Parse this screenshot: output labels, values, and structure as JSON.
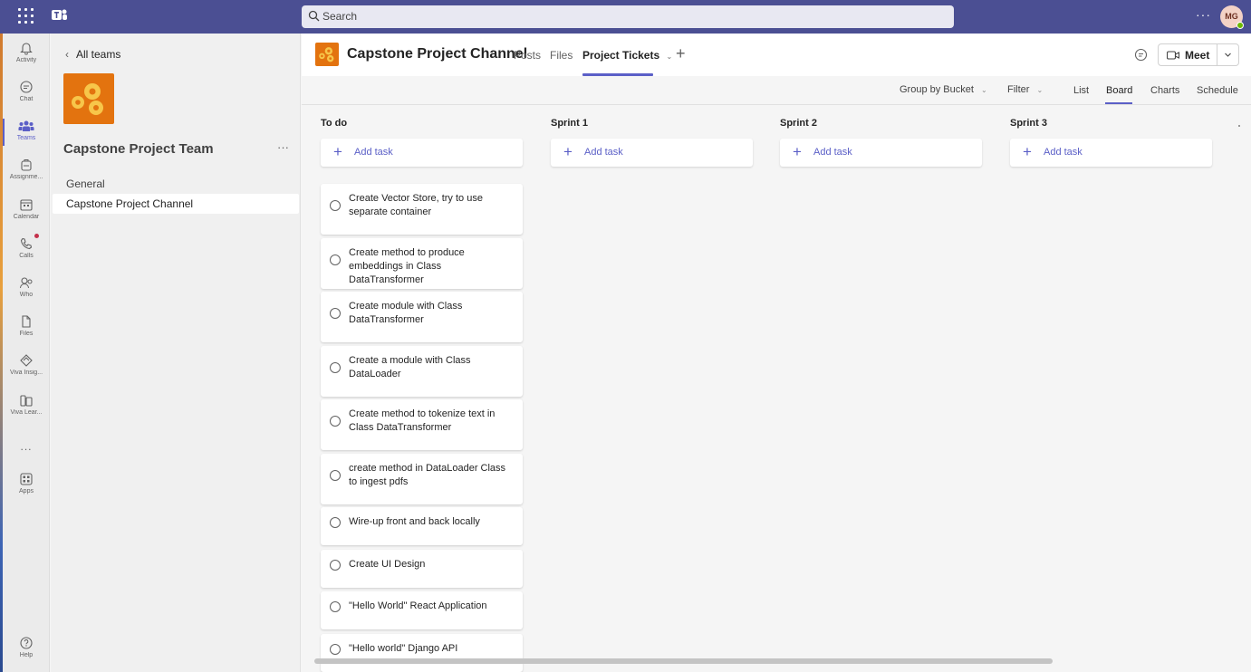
{
  "topbar": {
    "search_placeholder": "Search",
    "more": "···",
    "avatar_initials": "MG"
  },
  "rail": {
    "items": [
      {
        "label": "Activity",
        "icon": "bell-icon"
      },
      {
        "label": "Chat",
        "icon": "chat-icon"
      },
      {
        "label": "Teams",
        "icon": "teams-icon"
      },
      {
        "label": "Assignme...",
        "icon": "assignments-icon"
      },
      {
        "label": "Calendar",
        "icon": "calendar-icon"
      },
      {
        "label": "Calls",
        "icon": "phone-icon"
      },
      {
        "label": "Who",
        "icon": "who-icon"
      },
      {
        "label": "Files",
        "icon": "file-icon"
      },
      {
        "label": "Viva Insig...",
        "icon": "viva-insights-icon"
      },
      {
        "label": "Viva Lear...",
        "icon": "viva-learning-icon"
      },
      {
        "label": "...",
        "icon": "more-icon"
      },
      {
        "label": "Apps",
        "icon": "apps-icon"
      },
      {
        "label": "Help",
        "icon": "help-icon"
      }
    ]
  },
  "panel": {
    "back_label": "All teams",
    "team_name": "Capstone Project Team",
    "team_more": "···",
    "channels": [
      "General",
      "Capstone Project Channel"
    ]
  },
  "header": {
    "channel_title": "Capstone Project Channel",
    "tabs": [
      "Posts",
      "Files",
      "Project Tickets"
    ],
    "add_tab": "+",
    "meet_label": "Meet"
  },
  "toolbar": {
    "group_by": "Group by Bucket",
    "filter": "Filter",
    "views": [
      "List",
      "Board",
      "Charts",
      "Schedule"
    ],
    "selected_view": "Board"
  },
  "board": {
    "add_task_label": "Add task",
    "columns": [
      "To do",
      "Sprint 1",
      "Sprint 2",
      "Sprint 3"
    ],
    "todo_tasks": [
      "Create Vector Store, try to use separate container",
      "Create method to produce embeddings in Class DataTransformer",
      "Create module with Class DataTransformer",
      "Create a module with Class DataLoader",
      "Create method to tokenize text in Class DataTransformer",
      "create method in DataLoader Class to ingest pdfs",
      "Wire-up front and back locally",
      "Create UI Design",
      "\"Hello World\" React Application",
      "\"Hello world\" Django API"
    ]
  },
  "colors": {
    "topbar": "#4b4f93",
    "accent": "#5b5fc7",
    "team_logo": "#e3730f"
  }
}
